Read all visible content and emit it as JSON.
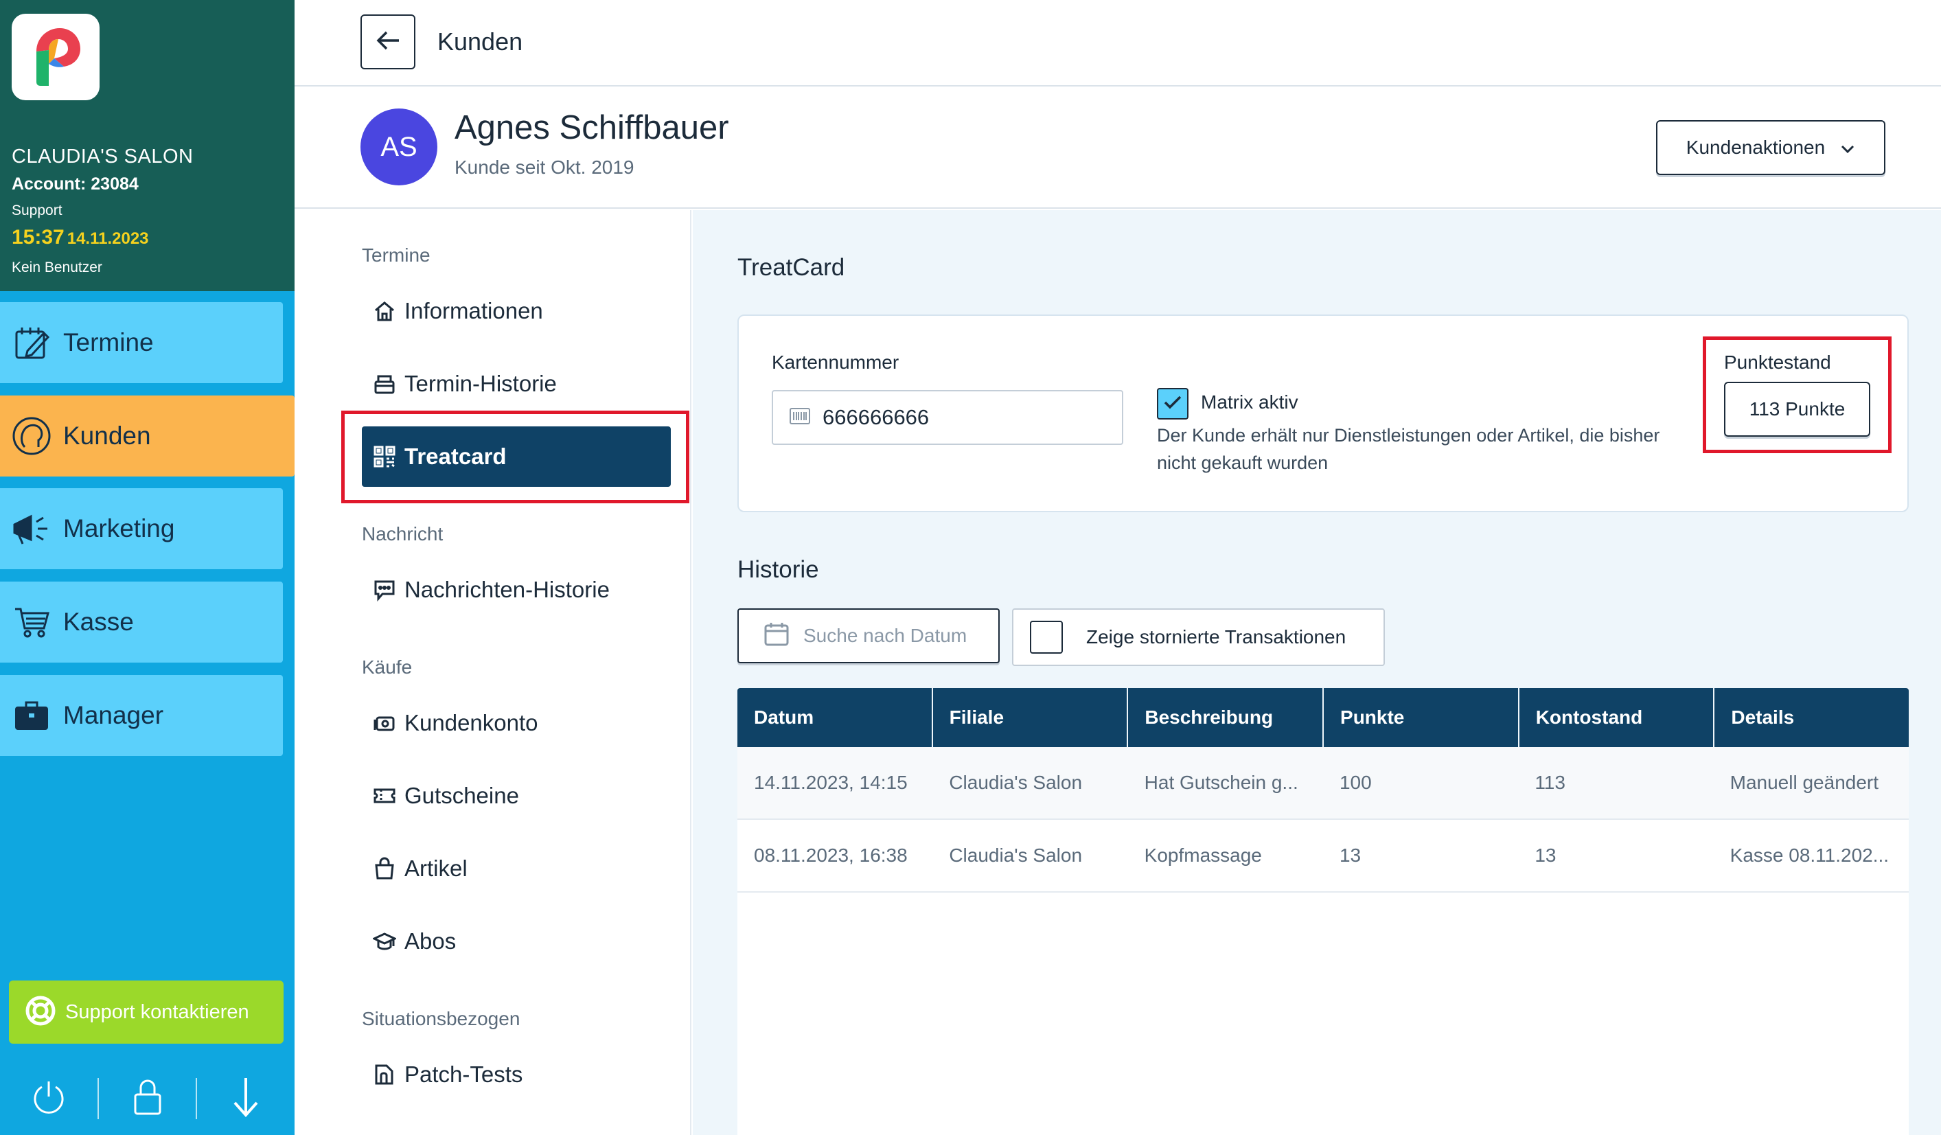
{
  "sidebar": {
    "salon_name": "CLAUDIA'S SALON",
    "account": "Account: 23084",
    "support_label": "Support",
    "time": "15:37",
    "date": "14.11.2023",
    "user": "Kein Benutzer",
    "items": [
      {
        "label": "Termine",
        "icon": "calendar-edit-icon"
      },
      {
        "label": "Kunden",
        "icon": "customer-head-icon",
        "active": true
      },
      {
        "label": "Marketing",
        "icon": "megaphone-icon"
      },
      {
        "label": "Kasse",
        "icon": "cart-icon"
      },
      {
        "label": "Manager",
        "icon": "briefcase-icon"
      }
    ],
    "support_button": "Support kontaktieren",
    "bottom_icons": [
      "power-icon",
      "lock-icon",
      "arrow-down-icon"
    ]
  },
  "topbar": {
    "breadcrumb": "Kunden"
  },
  "customer": {
    "initials": "AS",
    "name": "Agnes Schiffbauer",
    "since": "Kunde seit Okt. 2019",
    "actions_label": "Kundenaktionen"
  },
  "subnav": {
    "sections": {
      "termine": "Termine",
      "nachricht": "Nachricht",
      "kaeufe": "Käufe",
      "situation": "Situationsbezogen"
    },
    "items": {
      "informationen": "Informationen",
      "termin_historie": "Termin-Historie",
      "treatcard": "Treatcard",
      "nachrichten_historie": "Nachrichten-Historie",
      "kundenkonto": "Kundenkonto",
      "gutscheine": "Gutscheine",
      "artikel": "Artikel",
      "abos": "Abos",
      "patch_tests": "Patch-Tests"
    }
  },
  "treatcard": {
    "title": "TreatCard",
    "card_number_label": "Kartennummer",
    "card_number": "666666666",
    "matrix_label": "Matrix aktiv",
    "matrix_checked": true,
    "matrix_desc": "Der Kunde erhält nur Dienstleistungen oder Artikel, die bisher nicht gekauft wurden",
    "points_label": "Punktestand",
    "points_value": "113 Punkte"
  },
  "history": {
    "title": "Historie",
    "date_search": "Suche nach Datum",
    "show_cancelled": "Zeige stornierte Transaktionen",
    "columns": [
      "Datum",
      "Filiale",
      "Beschreibung",
      "Punkte",
      "Kontostand",
      "Details"
    ],
    "rows": [
      [
        "14.11.2023, 14:15",
        "Claudia's Salon",
        "Hat Gutschein g...",
        "100",
        "113",
        "Manuell geändert"
      ],
      [
        "08.11.2023, 16:38",
        "Claudia's Salon",
        "Kopfmassage",
        "13",
        "13",
        "Kasse 08.11.202..."
      ]
    ]
  },
  "colors": {
    "sidebar_head": "#175e56",
    "sidebar_bg": "#0fa7e0",
    "nav_item": "#5bd0fb",
    "nav_active": "#fbb44e",
    "primary_dark": "#0f4266",
    "avatar": "#4a46e0",
    "highlight_frame": "#e0182b",
    "support_green": "#9bd92a"
  }
}
